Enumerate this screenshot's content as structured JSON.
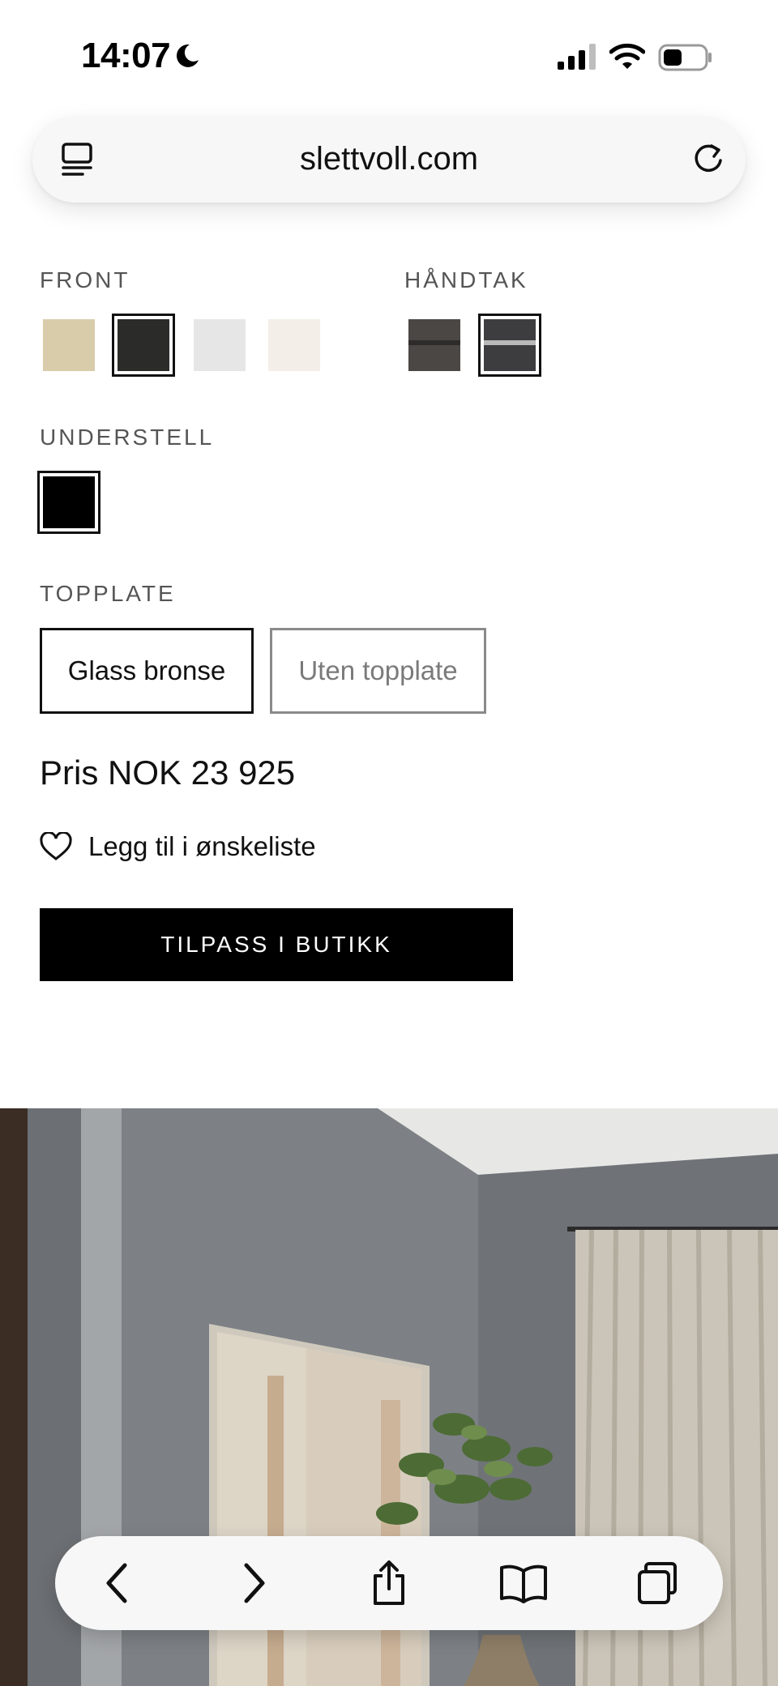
{
  "status_bar": {
    "time": "14:07",
    "icons": [
      "moon-icon",
      "cellular-signal-icon",
      "wifi-icon",
      "battery-icon"
    ]
  },
  "browser": {
    "url": "slettvoll.com",
    "icons": [
      "reader-view-icon",
      "reload-icon"
    ]
  },
  "options": {
    "front": {
      "label": "FRONT",
      "swatches": [
        {
          "name": "light-oak",
          "color": "#d9ccab",
          "selected": false
        },
        {
          "name": "black",
          "color": "#2b2b29",
          "selected": true
        },
        {
          "name": "light-grey",
          "color": "#e6e6e6",
          "selected": false
        },
        {
          "name": "off-white",
          "color": "#f3efe8",
          "selected": false
        }
      ]
    },
    "handle": {
      "label": "HÅNDTAK",
      "swatches": [
        {
          "name": "dark-bronze",
          "color": "#4a4744",
          "selected": false
        },
        {
          "name": "dark-grey",
          "color": "#3d3d3f",
          "selected": true
        }
      ]
    },
    "base": {
      "label": "UNDERSTELL",
      "swatches": [
        {
          "name": "black",
          "color": "#000000",
          "selected": true
        }
      ]
    },
    "top": {
      "label": "TOPPLATE",
      "choices": [
        {
          "label": "Glass bronse",
          "selected": true
        },
        {
          "label": "Uten topplate",
          "selected": false
        }
      ]
    }
  },
  "price": "Pris NOK 23 925",
  "wishlist_label": "Legg til i ønskeliste",
  "cta_label": "TILPASS I BUTIKK",
  "toolbar": {
    "icons": [
      "back-icon",
      "forward-icon",
      "share-icon",
      "bookmarks-icon",
      "tabs-icon"
    ]
  },
  "colors": {
    "accent": "#000000",
    "label_grey": "#555555"
  }
}
